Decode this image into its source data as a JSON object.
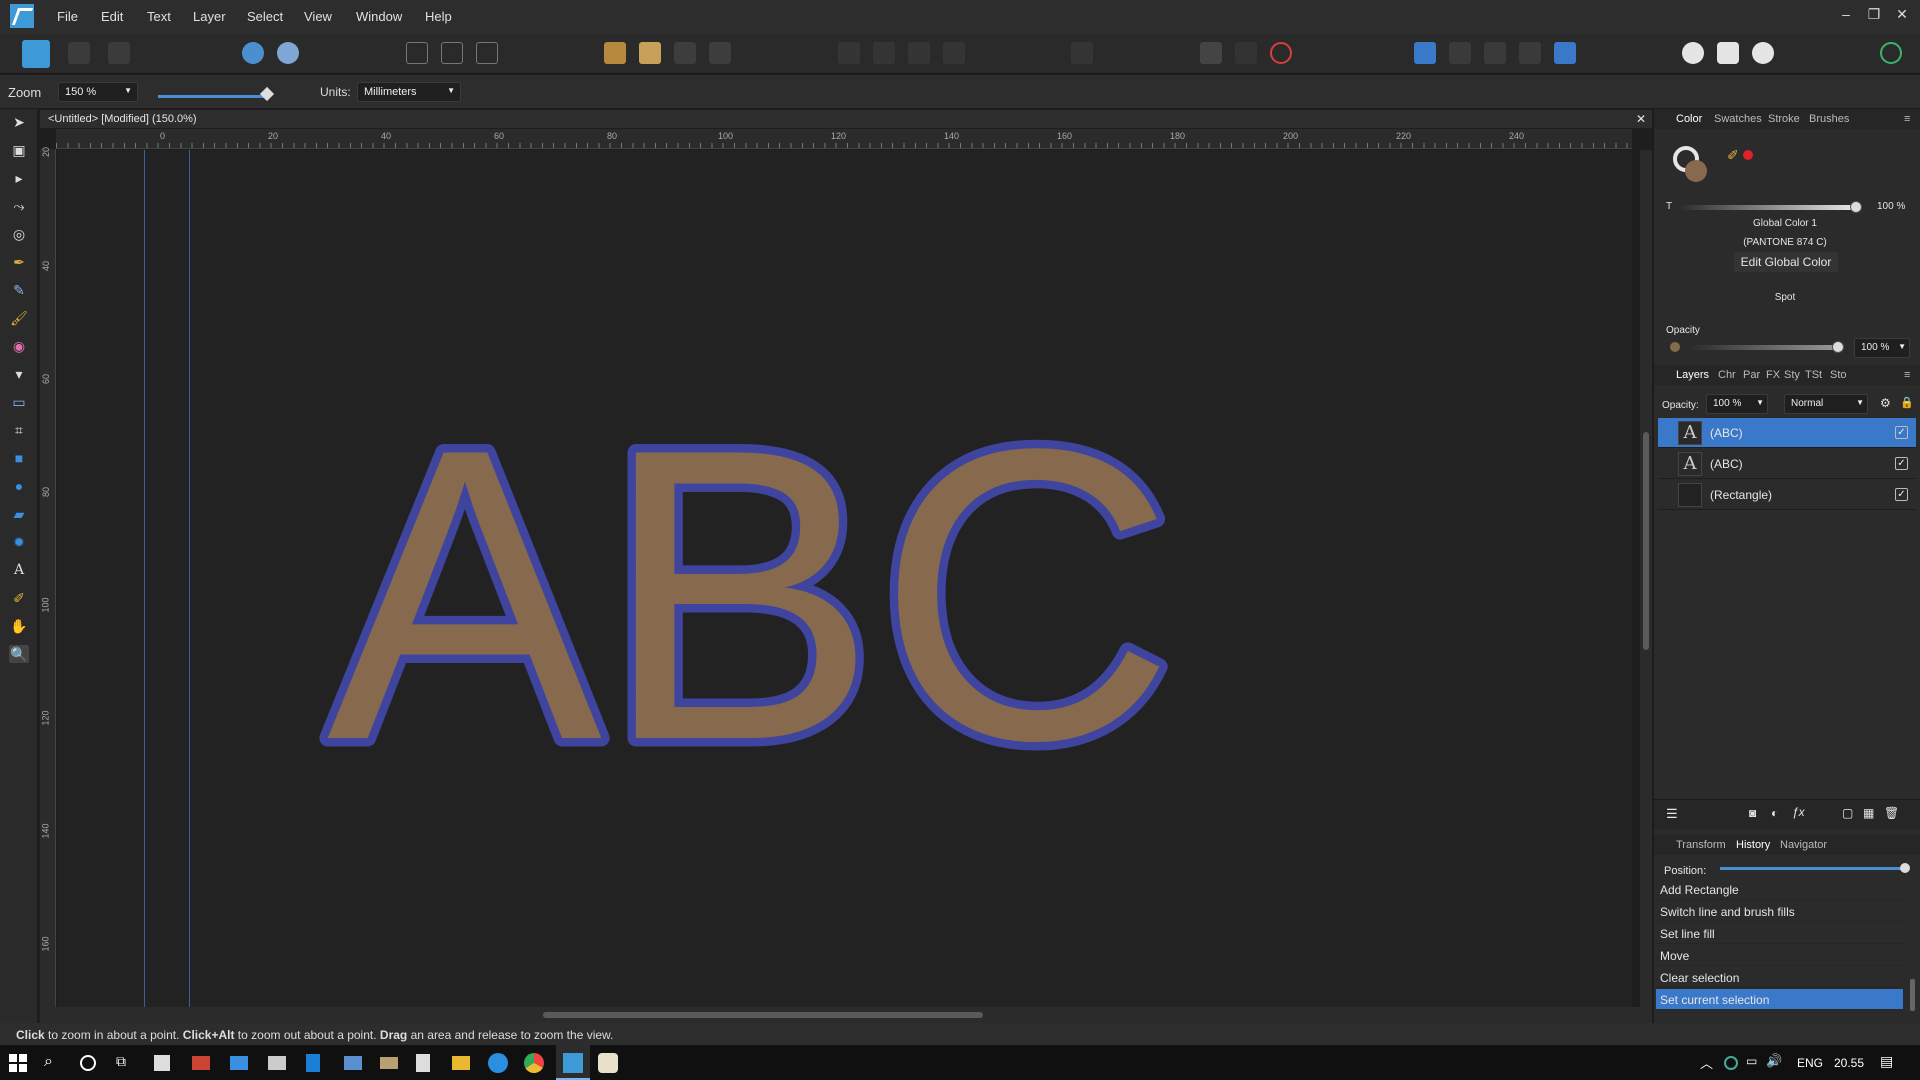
{
  "menu": [
    "File",
    "Edit",
    "Text",
    "Layer",
    "Select",
    "View",
    "Window",
    "Help"
  ],
  "window_controls": {
    "minimize": "–",
    "restore": "❐",
    "close": "✕"
  },
  "context": {
    "zoom_label": "Zoom",
    "zoom_value": "150 %",
    "units_label": "Units:",
    "units_value": "Millimeters"
  },
  "document": {
    "tab_title": "<Untitled> [Modified] (150.0%)",
    "close": "✕",
    "text": "ABC",
    "fill_color": "#876a4e",
    "stroke_color": "#3f449e",
    "canvas_color": "#222222"
  },
  "ruler": {
    "top": [
      "0",
      "20",
      "40",
      "60",
      "80",
      "100",
      "120",
      "140",
      "160",
      "180",
      "200",
      "220",
      "240"
    ],
    "left": [
      "20",
      "40",
      "60",
      "80",
      "100",
      "120",
      "140",
      "160"
    ]
  },
  "color_panel": {
    "tabs": [
      "Color",
      "Swatches",
      "Stroke",
      "Brushes"
    ],
    "t_label": "T",
    "tint_value": "100 %",
    "global_color": "Global Color 1",
    "pantone": "(PANTONE 874 C)",
    "edit_button": "Edit Global Color",
    "type": "Spot",
    "opacity_label": "Opacity",
    "opacity_value": "100 %",
    "swatch_color": "#876a4e",
    "red_dot": "#e0202a"
  },
  "layers_panel": {
    "tabs": [
      "Layers",
      "Chr",
      "Par",
      "FX",
      "Sty",
      "TSt",
      "Sto"
    ],
    "opacity_label": "Opacity:",
    "opacity_value": "100 %",
    "blend_mode": "Normal",
    "layers": [
      {
        "thumb": "A",
        "name": "(ABC)",
        "checked": "✓"
      },
      {
        "thumb": "A",
        "name": "(ABC)",
        "checked": "✓"
      },
      {
        "thumb": "",
        "name": "(Rectangle)",
        "checked": "✓"
      }
    ]
  },
  "history_panel": {
    "tabs": [
      "Transform",
      "History",
      "Navigator"
    ],
    "position_label": "Position:",
    "items": [
      "Add Rectangle",
      "Switch line and brush fills",
      "Set line fill",
      "Move",
      "Clear selection",
      "Set current selection"
    ]
  },
  "status": {
    "b1": "Click",
    "t1": " to zoom in about a point. ",
    "b2": "Click+Alt",
    "t2": " to zoom out about a point. ",
    "b3": "Drag",
    "t3": " an area and release to zoom the view."
  },
  "taskbar": {
    "lang": "ENG",
    "time": "20.55"
  },
  "accent_color": "#3a78c9"
}
